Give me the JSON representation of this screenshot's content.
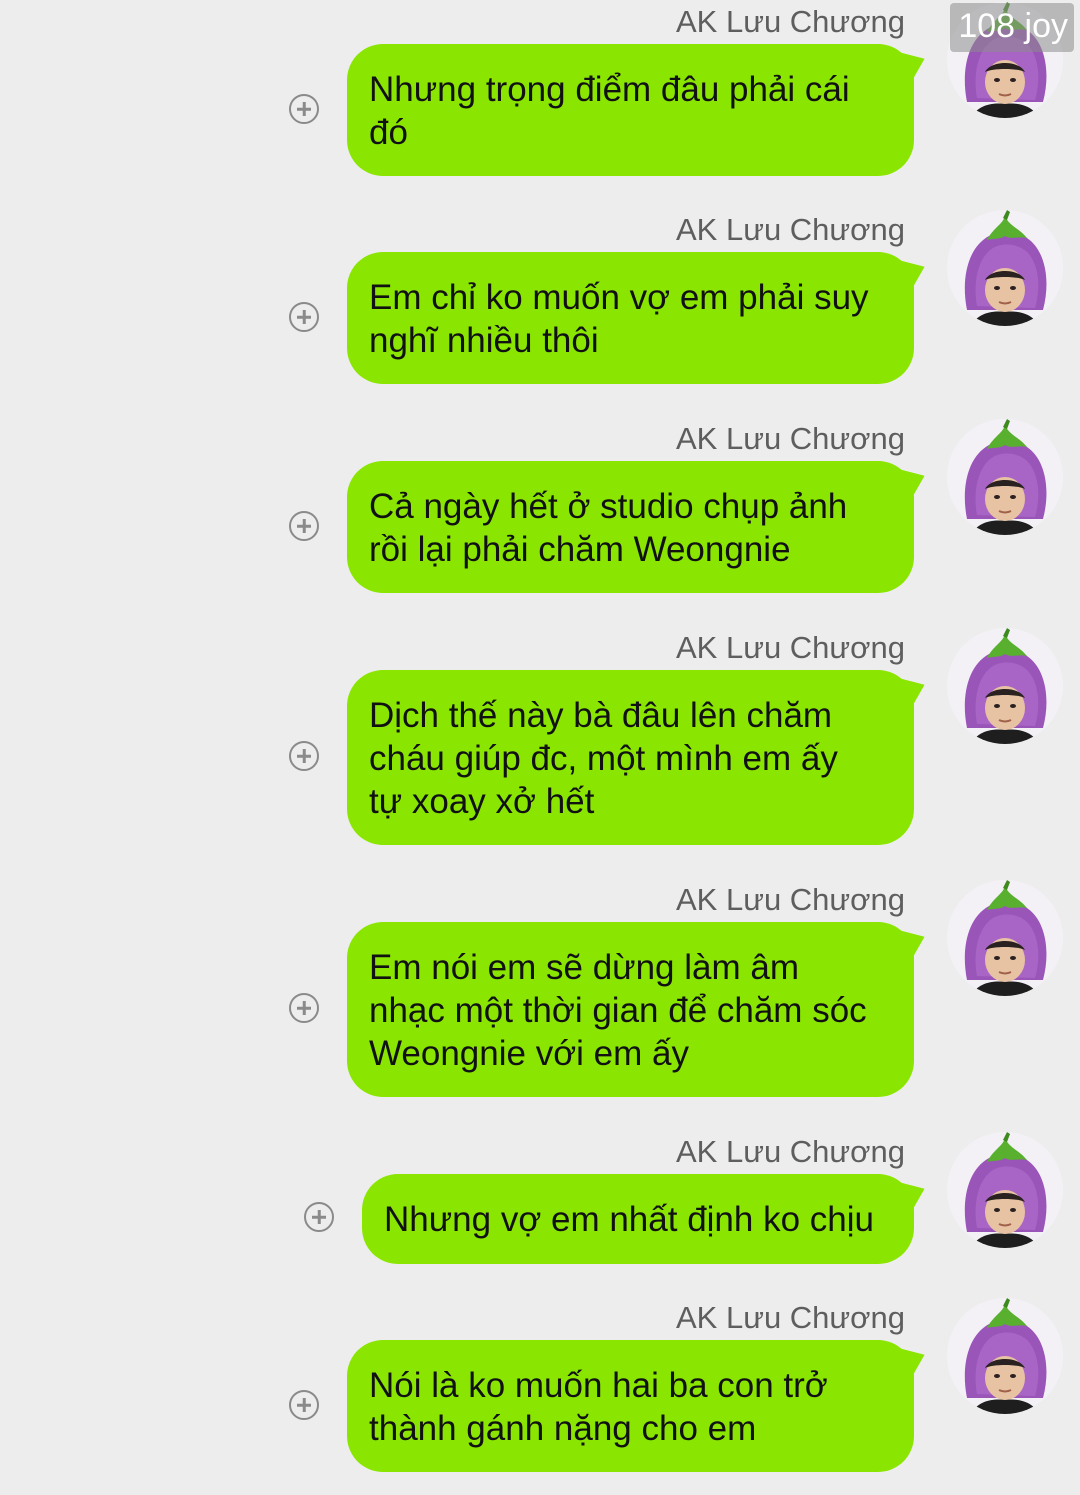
{
  "watermark": "108 joy",
  "messages": [
    {
      "sender": "AK Lưu Chương",
      "lines": [
        "Nhưng trọng điểm đâu phải cái",
        "đó"
      ]
    },
    {
      "sender": "AK Lưu Chương",
      "lines": [
        "Em chỉ ko muốn vợ em phải suy",
        "nghĩ nhiều thôi"
      ]
    },
    {
      "sender": "AK Lưu Chương",
      "lines": [
        "Cả ngày hết ở studio chụp ảnh",
        "rồi lại phải chăm Weongnie"
      ]
    },
    {
      "sender": "AK Lưu Chương",
      "lines": [
        "Dịch thế này bà đâu lên chăm",
        "cháu giúp đc, một mình em ấy",
        "tự xoay xở hết"
      ]
    },
    {
      "sender": "AK Lưu Chương",
      "lines": [
        "Em nói em sẽ dừng làm âm",
        "nhạc một thời gian để chăm sóc",
        "Weongnie với em ấy"
      ]
    },
    {
      "sender": "AK Lưu Chương",
      "lines": [
        "Nhưng vợ em nhất định ko chịu"
      ]
    },
    {
      "sender": "AK Lưu Chương",
      "lines": [
        "Nói là ko muốn hai ba con trở",
        "thành gánh nặng cho em"
      ]
    }
  ],
  "icons": {
    "add": "plus-circle-icon",
    "avatar": "eggplant-hat-avatar"
  },
  "colors": {
    "background": "#ededed",
    "bubble": "#8ae600",
    "sender_text": "#5e5e5e"
  }
}
